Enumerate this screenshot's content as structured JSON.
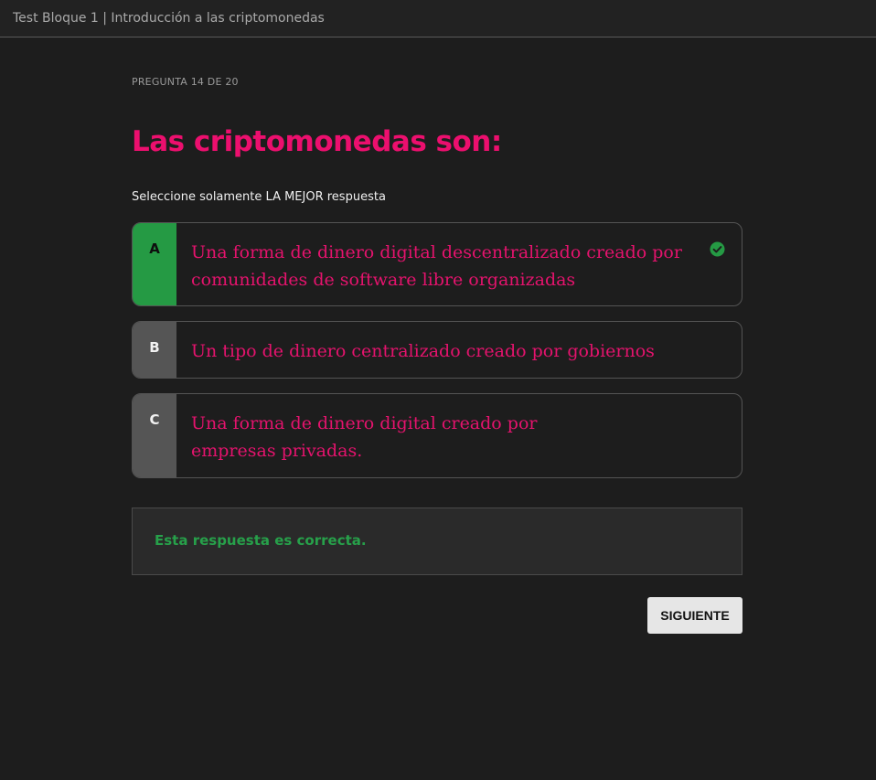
{
  "window": {
    "title": "Test Bloque 1 | Introducción a las criptomonedas"
  },
  "quiz": {
    "progress": "PREGUNTA 14 DE 20",
    "question": "Las criptomonedas son:",
    "instruction": "Seleccione solamente LA MEJOR respuesta",
    "options": [
      {
        "letter": "A",
        "text": "Una forma de dinero digital descentralizado creado por comunidades de software libre organizadas",
        "state": "selected-correct",
        "icon": "check-circle-icon"
      },
      {
        "letter": "B",
        "text": "Un tipo de dinero centralizado creado por gobiernos",
        "state": "unselected"
      },
      {
        "letter": "C",
        "text": "Una forma de dinero digital creado por empresas privadas.",
        "state": "unselected"
      }
    ],
    "feedback": "Esta respuesta es correcta.",
    "next_label": "SIGUIENTE"
  },
  "colors": {
    "background": "#1d1d1d",
    "accent_pink": "#ec0f6e",
    "correct_green": "#259a44",
    "letter_gray": "#555555",
    "button_bg": "#e6e6e6"
  }
}
